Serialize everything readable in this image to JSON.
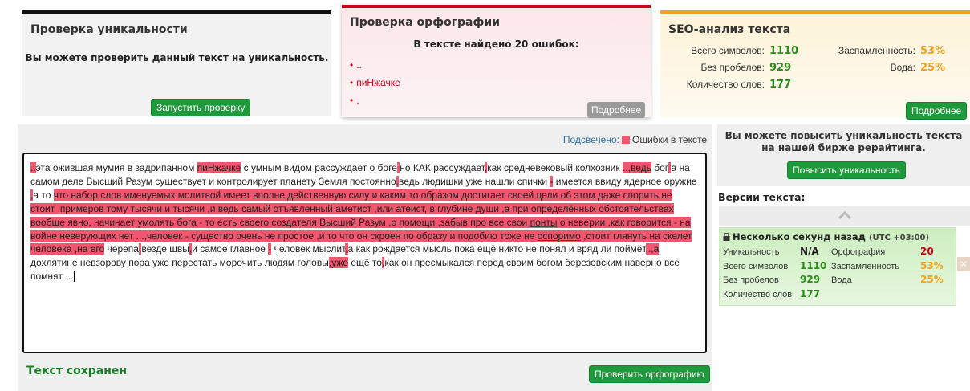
{
  "uniqueness": {
    "title": "Проверка уникальности",
    "text": "Вы можете проверить данный текст на уникальность.",
    "button": "Запустить проверку"
  },
  "spelling": {
    "title": "Проверка орфографии",
    "found": "В тексте найдено 20 ошибок:",
    "errors": [
      "..",
      "пиНжачке",
      ","
    ],
    "more": "Подробнее"
  },
  "seo": {
    "title": "SEO-анализ текста",
    "total_label": "Всего символов:",
    "total_value": "1110",
    "nospace_label": "Без пробелов:",
    "nospace_value": "929",
    "words_label": "Количество слов:",
    "words_value": "177",
    "spam_label": "Заспамленность:",
    "spam_value": "53%",
    "water_label": "Вода:",
    "water_value": "25%",
    "more": "Подробнее"
  },
  "editor": {
    "legend_label": "Подсвечено:",
    "legend_text": "Ошибки в тексте",
    "saved": "Текст сохранен",
    "check_button": "Проверить орфографию",
    "segments": [
      {
        "t": "..",
        "m": true
      },
      {
        "t": "эта ожившая мумия в задрипанном "
      },
      {
        "t": "пиНжачке",
        "m": true
      },
      {
        "t": " с умным видом рассуждает о боге"
      },
      {
        "t": " ",
        "m": true
      },
      {
        "t": "но КАК рассуждает"
      },
      {
        "t": ",",
        "m": true
      },
      {
        "t": "как средневековый колхозник "
      },
      {
        "t": "..,ведь",
        "m": true
      },
      {
        "t": " бог"
      },
      {
        "t": " ",
        "m": true
      },
      {
        "t": "а на самом деле Высший Разум существует и контролирует планету Земля постоянно"
      },
      {
        "t": ",",
        "m": true
      },
      {
        "t": "ведь людишки уже нашли спички "
      },
      {
        "t": "-",
        "m": true
      },
      {
        "t": " имеется ввиду ядерное оружие "
      },
      {
        "t": ",",
        "m": true
      },
      {
        "t": "а то "
      },
      {
        "t": "что набор слов именуемых молитвой имеет вполне действенную силу и каким то образом достигает своей цели об этом даже спорить не стоит ,примеров тому тысячи и тысячи ,и ведь самый отъявленный аметист ,или атеист, в глубине души ,а при определённых обстоятельствах вообще явно, начинает умолять бога - то есть своего создателя Высший Разум ,о помощи ,забыв про все свои ",
        "m": true
      },
      {
        "t": "понты",
        "m": true,
        "u": true
      },
      {
        "t": " о неверии ,как говорится - на войне неверующих нет ...,человек - существо очень не простое ,и то что он скроен по образу и подобию тоже не ",
        "m": true
      },
      {
        "t": "оспоримо",
        "m": true,
        "u": true
      },
      {
        "t": " ,стоит глянуть на скелет человека ,на его",
        "m": true
      },
      {
        "t": " черепа"
      },
      {
        "t": ",",
        "m": true
      },
      {
        "t": "везде швы"
      },
      {
        "t": ",",
        "m": true
      },
      {
        "t": "и самое главное "
      },
      {
        "t": "-",
        "m": true
      },
      {
        "t": " человек мыслит"
      },
      {
        "t": ",",
        "m": true
      },
      {
        "t": "а как рождается мысль пока ещё никто не понял и вряд ли поймёт"
      },
      {
        "t": "..,а",
        "m": true
      },
      {
        "t": " дохлятине "
      },
      {
        "t": "невзорову",
        "u": true
      },
      {
        "t": " пора уже перестать морочить людям головы"
      },
      {
        "t": ",уже",
        "m": true
      },
      {
        "t": " ещё то"
      },
      {
        "t": ",",
        "m": true
      },
      {
        "t": "как он пресмыкался перед своим богом "
      },
      {
        "t": "березовским",
        "u": true
      },
      {
        "t": " наверно все помнят ..."
      }
    ]
  },
  "promo": {
    "text": "Вы можете повысить уникальность текста на нашей бирже рерайтинга.",
    "button": "Повысить уникальность"
  },
  "versions": {
    "title": "Версии текста:",
    "when": "Несколько секунд назад",
    "tz": "(UTC +03:00)",
    "uniq_label": "Уникальность",
    "uniq_value": "N/A",
    "total_label": "Всего символов",
    "total_value": "1110",
    "nospace_label": "Без пробелов",
    "nospace_value": "929",
    "words_label": "Количество слов",
    "words_value": "177",
    "spell_label": "Орфография",
    "spell_value": "20",
    "spam_label": "Заспамленность",
    "spam_value": "53%",
    "water_label": "Вода",
    "water_value": "25%"
  },
  "colors": {
    "highlight": "#f0566d",
    "green_button": "#1e9a3c",
    "error_red": "#d0001c",
    "seo_orange": "#f2a21b"
  }
}
